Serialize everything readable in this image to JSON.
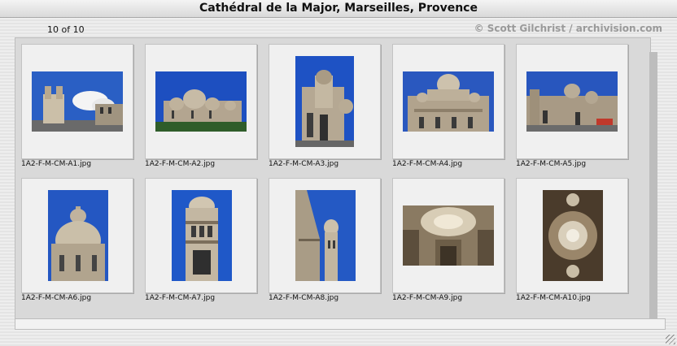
{
  "window": {
    "title": "Cathédral de la Major, Marseilles, Provence"
  },
  "header": {
    "count": "10 of 10",
    "credit": "© Scott Gilchrist / archivision.com"
  },
  "thumbnails": [
    {
      "filename": "1A2-F-M-CM-A1.jpg"
    },
    {
      "filename": "1A2-F-M-CM-A2.jpg"
    },
    {
      "filename": "1A2-F-M-CM-A3.jpg"
    },
    {
      "filename": "1A2-F-M-CM-A4.jpg"
    },
    {
      "filename": "1A2-F-M-CM-A5.jpg"
    },
    {
      "filename": "1A2-F-M-CM-A6.jpg"
    },
    {
      "filename": "1A2-F-M-CM-A7.jpg"
    },
    {
      "filename": "1A2-F-M-CM-A8.jpg"
    },
    {
      "filename": "1A2-F-M-CM-A9.jpg"
    },
    {
      "filename": "1A2-F-M-CM-A10.jpg"
    }
  ],
  "colors": {
    "sky": "#1f4fb8",
    "stone": "#b9ab97",
    "credit": "#9a9a9a"
  }
}
